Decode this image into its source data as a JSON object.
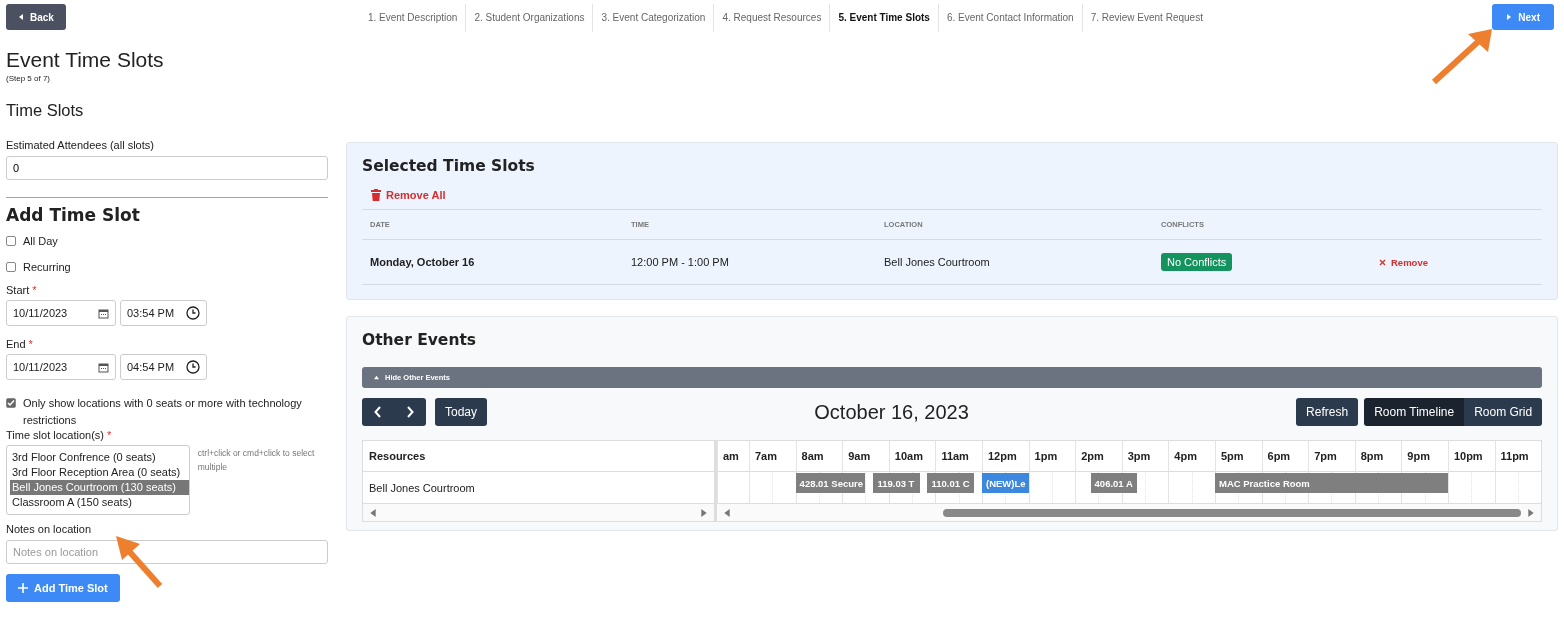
{
  "back_button": {
    "label": "Back"
  },
  "steps": [
    {
      "label": "1. Event Description",
      "selected": false
    },
    {
      "label": "2. Student Organizations",
      "selected": false
    },
    {
      "label": "3. Event Categorization",
      "selected": false
    },
    {
      "label": "4. Request Resources",
      "selected": false
    },
    {
      "label": "5. Event Time Slots",
      "selected": true
    },
    {
      "label": "6. Event Contact Information",
      "selected": false
    },
    {
      "label": "7. Review Event Request",
      "selected": false
    }
  ],
  "next_button": {
    "label": "Next"
  },
  "page": {
    "title": "Event Time Slots",
    "subtitle": "(Step 5 of 7)"
  },
  "form": {
    "section_title": "Time Slots",
    "attendees": {
      "label": "Estimated Attendees (all slots)",
      "value": "0"
    },
    "add_title": "Add Time Slot",
    "checks": [
      {
        "label": "All Day",
        "checked": false
      },
      {
        "label": "Recurring",
        "checked": false
      }
    ],
    "start": {
      "label": "Start",
      "required": "*",
      "date": "10/11/2023",
      "time": "03:54 PM"
    },
    "end": {
      "label": "End",
      "required": "*",
      "date": "10/11/2023",
      "time": "04:54 PM"
    },
    "filter": {
      "label": "Only show locations with 0 seats or more with technology restrictions",
      "checked": true
    },
    "locations": {
      "label": "Time slot location(s)",
      "required": "*",
      "hint": "ctrl+click or cmd+click to select multiple",
      "options": [
        {
          "label": "3rd Floor Confrence (0 seats)",
          "selected": false
        },
        {
          "label": "3rd Floor Reception Area (0 seats)",
          "selected": false
        },
        {
          "label": "Bell Jones Courtroom (130 seats)",
          "selected": true
        },
        {
          "label": "Classroom A (150 seats)",
          "selected": false
        }
      ]
    },
    "notes": {
      "label": "Notes on location",
      "placeholder": "Notes on location"
    },
    "add_button": {
      "label": "Add Time Slot"
    }
  },
  "selected_slots": {
    "title": "Selected Time Slots",
    "remove_all": "Remove All",
    "columns": [
      "DATE",
      "TIME",
      "LOCATION",
      "CONFLICTS"
    ],
    "rows": [
      {
        "date": "Monday, October 16",
        "time": "12:00 PM - 1:00 PM",
        "location": "Bell Jones Courtroom",
        "conflicts": "No Conflicts",
        "remove": "Remove"
      }
    ]
  },
  "other_events": {
    "title": "Other Events",
    "toggle": "Hide Other Events",
    "today": "Today",
    "date": "October 16, 2023",
    "refresh": "Refresh",
    "views": [
      {
        "label": "Room Timeline",
        "selected": true
      },
      {
        "label": "Room Grid",
        "selected": false
      }
    ],
    "resources_header": "Resources",
    "hours": [
      "am",
      "7am",
      "8am",
      "9am",
      "10am",
      "11am",
      "12pm",
      "1pm",
      "2pm",
      "3pm",
      "4pm",
      "5pm",
      "6pm",
      "7pm",
      "8pm",
      "9pm",
      "10pm",
      "11pm"
    ],
    "resources": [
      {
        "name": "Bell Jones Courtroom",
        "events": [
          {
            "label": "428.01 Secure",
            "kind": "other"
          },
          {
            "label": "119.03 T",
            "kind": "other"
          },
          {
            "label": "110.01 C",
            "kind": "other"
          },
          {
            "label": "(NEW)Le",
            "kind": "new"
          },
          {
            "label": "406.01 A",
            "kind": "other"
          },
          {
            "label": "MAC Practice Room",
            "kind": "other"
          }
        ]
      }
    ]
  }
}
